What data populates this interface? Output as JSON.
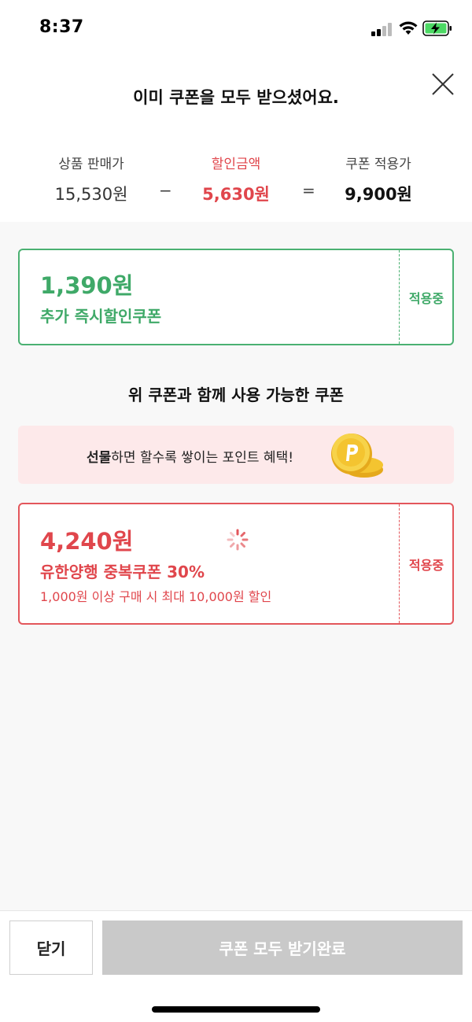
{
  "status_bar": {
    "time": "8:37"
  },
  "header": {
    "title": "이미 쿠폰을 모두 받으셨어요."
  },
  "price_summary": {
    "original_label": "상품 판매가",
    "original_value": "15,530원",
    "minus": "−",
    "discount_label": "할인금액",
    "discount_value": "5,630원",
    "equals": "=",
    "final_label": "쿠폰 적용가",
    "final_value": "9,900원"
  },
  "coupons": [
    {
      "amount": "1,390원",
      "name": "추가 즉시할인쿠폰",
      "status": "적용중"
    },
    {
      "amount": "4,240원",
      "name": "유한양행 중복쿠폰 30%",
      "condition": "1,000원 이상 구매 시 최대 10,000원 할인",
      "status": "적용중"
    }
  ],
  "combo_section": {
    "title": "위 쿠폰과 함께 사용 가능한 쿠폰"
  },
  "promo": {
    "bold": "선물",
    "text": "하면 할수록 쌓이는 포인트 혜택!",
    "icon": "point-coin-icon"
  },
  "footer": {
    "close_label": "닫기",
    "done_label": "쿠폰 모두 받기완료"
  },
  "colors": {
    "green": "#4bb172",
    "red": "#e0464c",
    "promo_bg": "#fde9ea",
    "disabled_button": "#c9c9c9"
  }
}
